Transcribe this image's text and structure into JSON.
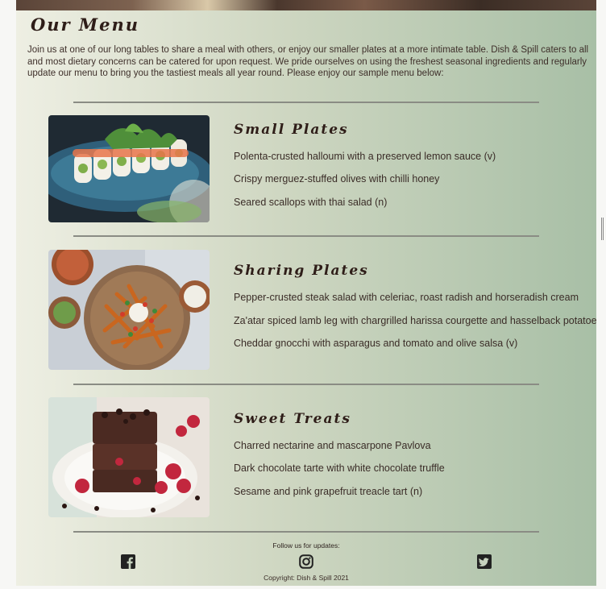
{
  "menu": {
    "title": "Our Menu",
    "intro": "Join us at one of our long tables to share a meal with others, or enjoy our smaller plates at a more intimate table. Dish & Spill caters to all and most dietary concerns can be catered for upon request. We pride ourselves on using the freshest seasonal ingredients and regularly update our menu to bring you the tastiest meals all year round. Please enjoy our sample menu below:"
  },
  "sections": [
    {
      "title": "Small Plates",
      "image": "sushi-rolls-photo",
      "items": [
        "Polenta-crusted halloumi with a preserved lemon sauce (v)",
        "Crispy merguez-stuffed olives with chilli honey",
        "Seared scallops with thai salad (n)"
      ]
    },
    {
      "title": "Sharing Plates",
      "image": "loaded-fries-photo",
      "items": [
        "Pepper-crusted steak salad with celeriac, roast radish and horseradish cream",
        "Za'atar spiced lamb leg with chargrilled harissa courgette and hasselback potatoes",
        "Cheddar gnocchi with asparagus and tomato and olive salsa (v)"
      ]
    },
    {
      "title": "Sweet Treats",
      "image": "chocolate-brownie-photo",
      "items": [
        "Charred nectarine and mascarpone Pavlova",
        "Dark chocolate tarte with white chocolate truffle",
        "Sesame and pink grapefruit treacle tart (n)"
      ]
    }
  ],
  "footer": {
    "follow": "Follow us for updates:",
    "social": [
      "facebook-icon",
      "instagram-icon",
      "twitter-icon"
    ],
    "copyright": "Copyright: Dish & Spill 2021"
  },
  "colors": {
    "gradient_start": "#eeefe3",
    "gradient_end": "#a8bfa6",
    "text": "#3a2c27",
    "divider": "#8a8c84"
  }
}
